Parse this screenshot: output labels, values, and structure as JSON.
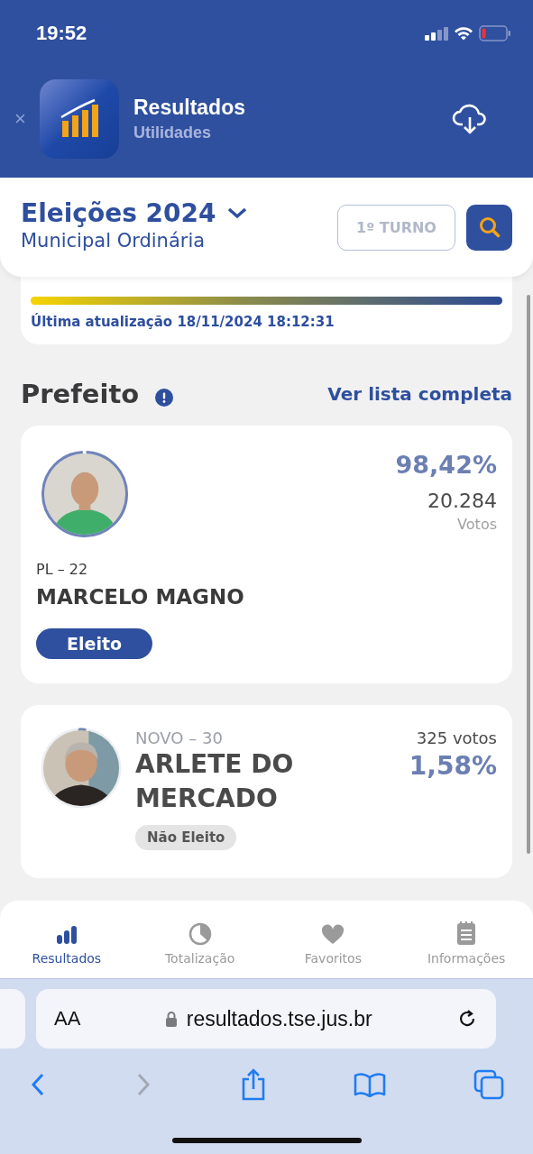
{
  "status_bar": {
    "time": "19:52"
  },
  "app_banner": {
    "close": "×",
    "title": "Resultados",
    "subtitle": "Utilidades"
  },
  "header": {
    "title": "Eleições 2024",
    "subtitle": "Municipal Ordinária",
    "round_button": "1º TURNO"
  },
  "progress_card": {
    "level": 1,
    "updated": "Última atualização 18/11/2024 18:12:31"
  },
  "section": {
    "title": "Prefeito",
    "link": "Ver lista completa"
  },
  "candidates": [
    {
      "kind": "featured",
      "party": "PL – 22",
      "name": "MARCELO MAGNO",
      "percent": "98,42%",
      "votes": "20.284",
      "votes_label": "Votos",
      "status": "Eleito",
      "elected": true
    },
    {
      "kind": "compact",
      "party": "NOVO – 30",
      "name": "ARLETE DO MERCADO",
      "percent": "1,58%",
      "votes": "325 votos",
      "status": "Não Eleito",
      "elected": false
    }
  ],
  "tabs": [
    {
      "label": "Resultados",
      "selected": true
    },
    {
      "label": "Totalização",
      "selected": false
    },
    {
      "label": "Favoritos",
      "selected": false
    },
    {
      "label": "Informações",
      "selected": false
    }
  ],
  "browser": {
    "text_size": "AA",
    "url": "resultados.tse.jus.br"
  }
}
